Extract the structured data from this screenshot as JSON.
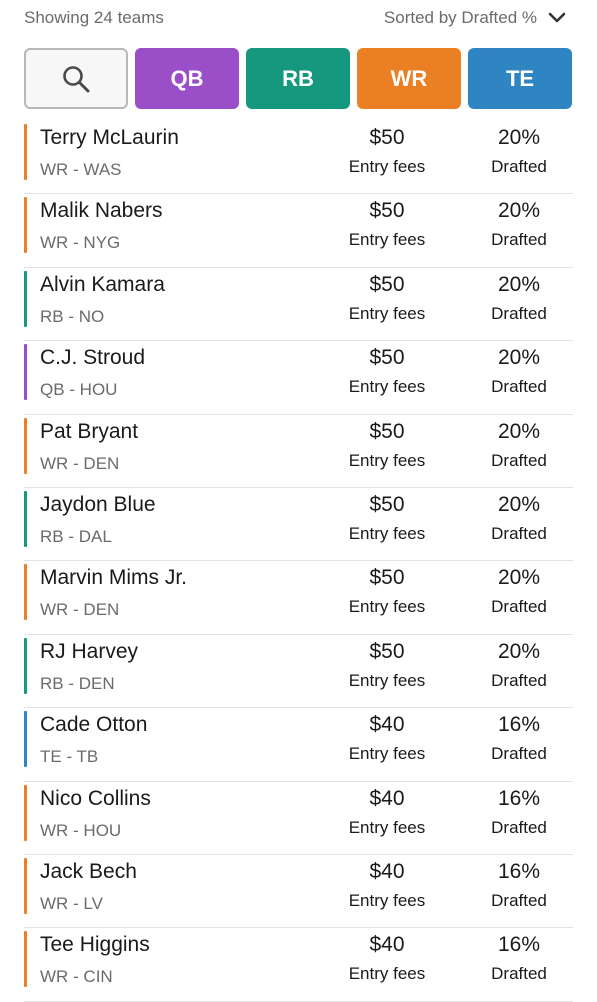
{
  "header": {
    "count_text": "Showing 24 teams",
    "sort_text": "Sorted by Drafted %"
  },
  "filters": {
    "search_icon": "search-icon",
    "qb_label": "QB",
    "rb_label": "RB",
    "wr_label": "WR",
    "te_label": "TE"
  },
  "colors": {
    "QB": "#9a4ec8",
    "RB": "#16987f",
    "WR": "#ea7f24",
    "TE": "#2e85c1"
  },
  "players": [
    {
      "name": "Terry McLaurin",
      "pos_team": "WR - WAS",
      "position": "WR",
      "fee": "$50",
      "fee_label": "Entry fees",
      "pct": "20%",
      "pct_label": "Drafted"
    },
    {
      "name": "Malik Nabers",
      "pos_team": "WR - NYG",
      "position": "WR",
      "fee": "$50",
      "fee_label": "Entry fees",
      "pct": "20%",
      "pct_label": "Drafted"
    },
    {
      "name": "Alvin Kamara",
      "pos_team": "RB - NO",
      "position": "RB",
      "fee": "$50",
      "fee_label": "Entry fees",
      "pct": "20%",
      "pct_label": "Drafted"
    },
    {
      "name": "C.J. Stroud",
      "pos_team": "QB - HOU",
      "position": "QB",
      "fee": "$50",
      "fee_label": "Entry fees",
      "pct": "20%",
      "pct_label": "Drafted"
    },
    {
      "name": "Pat Bryant",
      "pos_team": "WR - DEN",
      "position": "WR",
      "fee": "$50",
      "fee_label": "Entry fees",
      "pct": "20%",
      "pct_label": "Drafted"
    },
    {
      "name": "Jaydon Blue",
      "pos_team": "RB - DAL",
      "position": "RB",
      "fee": "$50",
      "fee_label": "Entry fees",
      "pct": "20%",
      "pct_label": "Drafted"
    },
    {
      "name": "Marvin Mims Jr.",
      "pos_team": "WR - DEN",
      "position": "WR",
      "fee": "$50",
      "fee_label": "Entry fees",
      "pct": "20%",
      "pct_label": "Drafted"
    },
    {
      "name": "RJ Harvey",
      "pos_team": "RB - DEN",
      "position": "RB",
      "fee": "$50",
      "fee_label": "Entry fees",
      "pct": "20%",
      "pct_label": "Drafted"
    },
    {
      "name": "Cade Otton",
      "pos_team": "TE - TB",
      "position": "TE",
      "fee": "$40",
      "fee_label": "Entry fees",
      "pct": "16%",
      "pct_label": "Drafted"
    },
    {
      "name": "Nico Collins",
      "pos_team": "WR - HOU",
      "position": "WR",
      "fee": "$40",
      "fee_label": "Entry fees",
      "pct": "16%",
      "pct_label": "Drafted"
    },
    {
      "name": "Jack Bech",
      "pos_team": "WR - LV",
      "position": "WR",
      "fee": "$40",
      "fee_label": "Entry fees",
      "pct": "16%",
      "pct_label": "Drafted"
    },
    {
      "name": "Tee Higgins",
      "pos_team": "WR - CIN",
      "position": "WR",
      "fee": "$40",
      "fee_label": "Entry fees",
      "pct": "16%",
      "pct_label": "Drafted"
    }
  ]
}
